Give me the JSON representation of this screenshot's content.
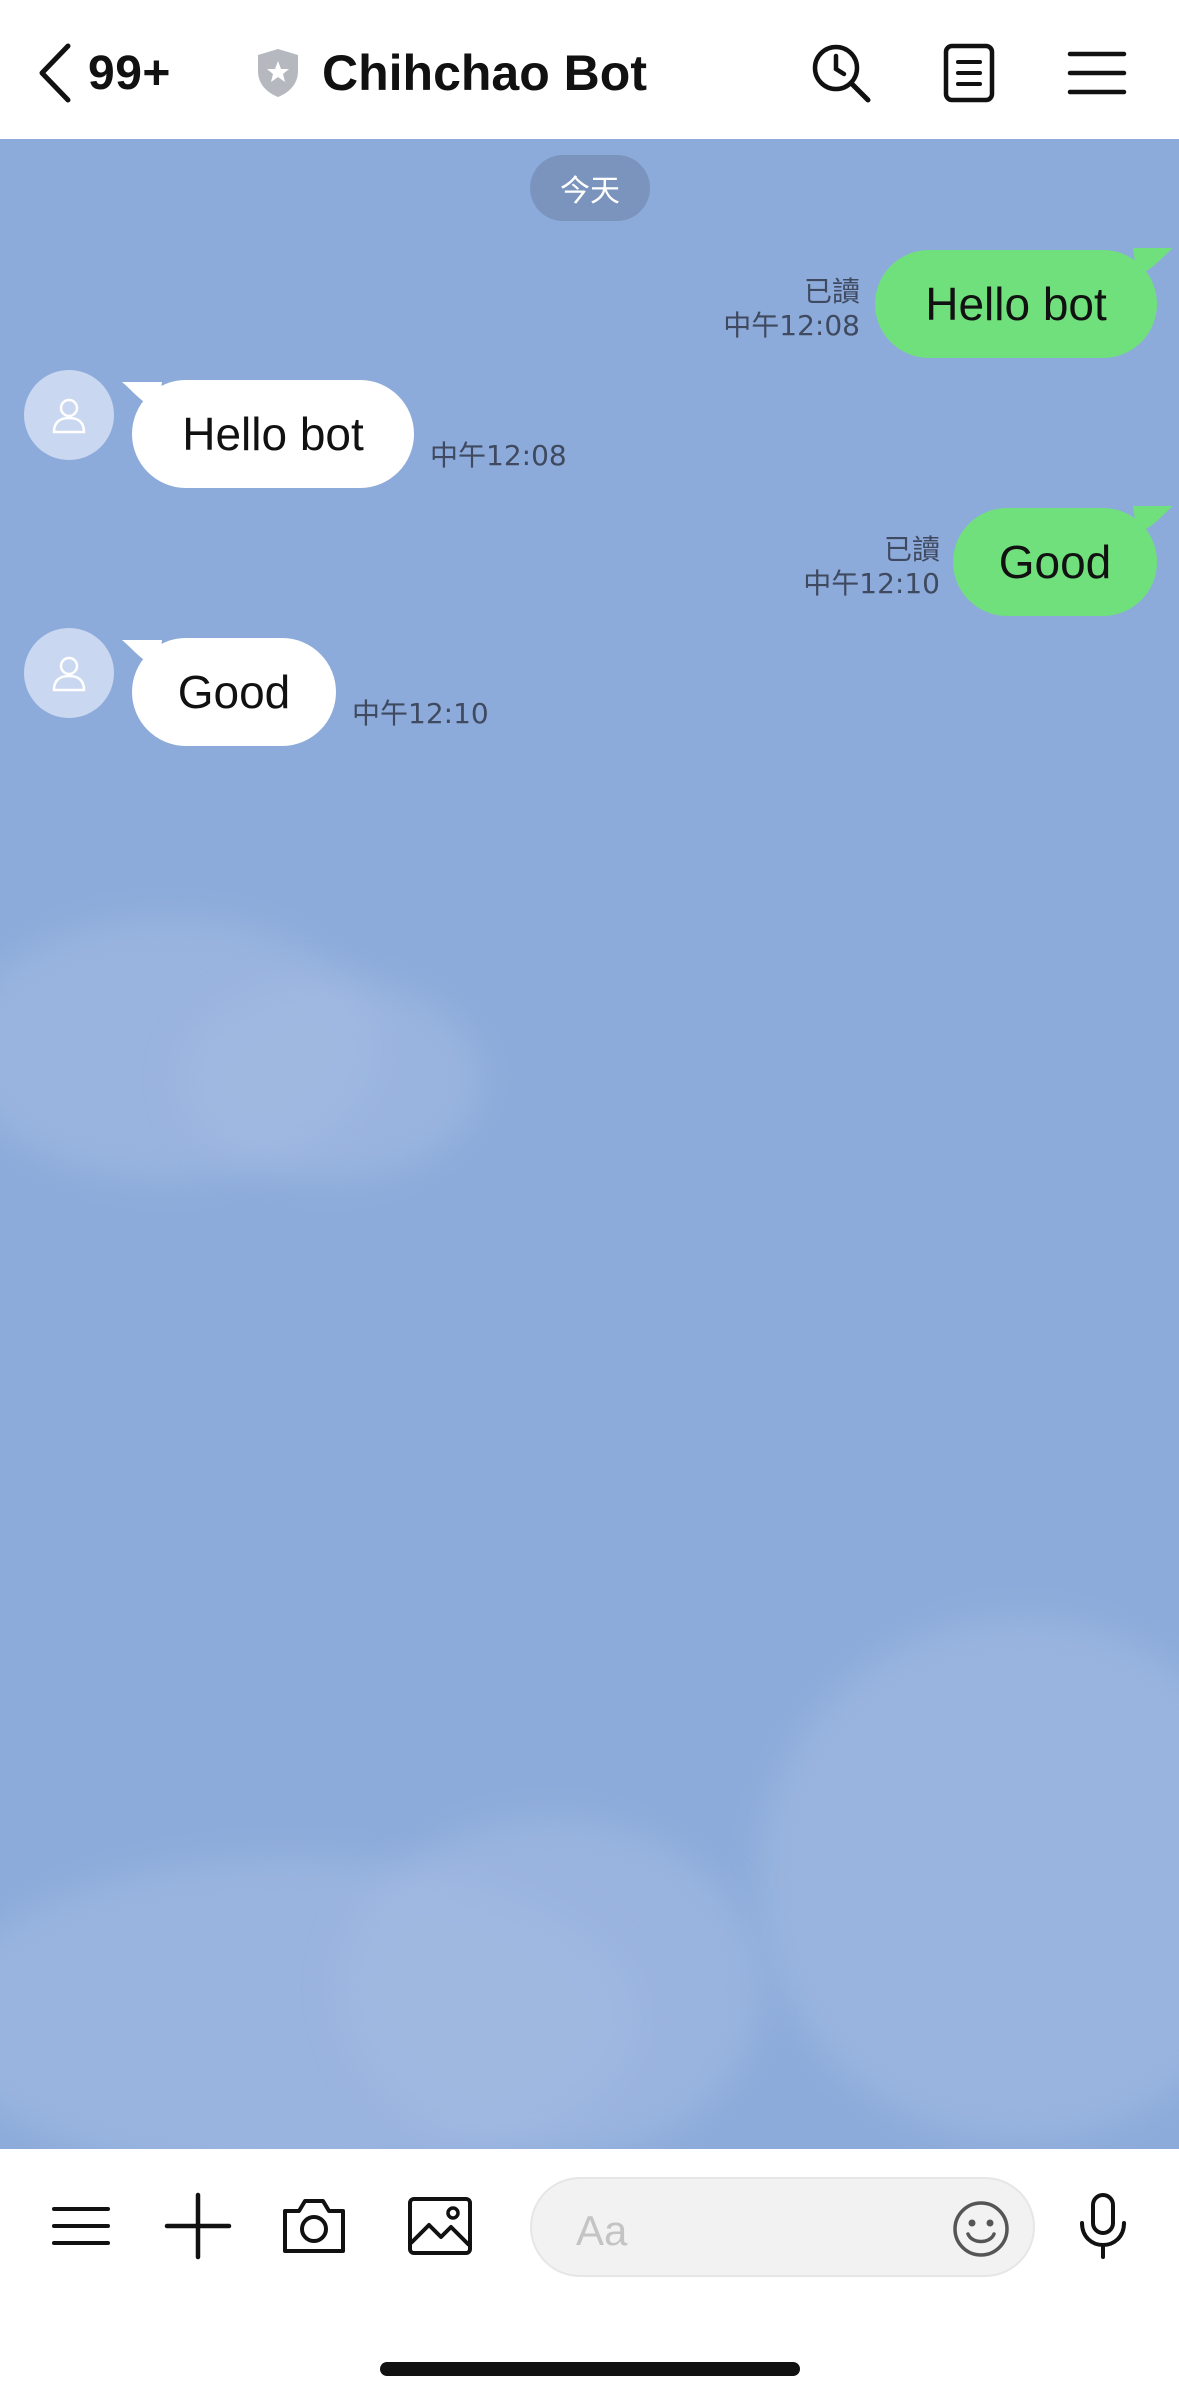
{
  "header": {
    "unread_count": "99+",
    "title": "Chihchao Bot",
    "icons": [
      "chevron-left-icon",
      "shield-icon",
      "search-clock-icon",
      "notes-icon",
      "menu-icon"
    ]
  },
  "chat": {
    "date_label": "今天",
    "messages": [
      {
        "direction": "out",
        "text": "Hello bot",
        "read": "已讀",
        "time": "中午12:08"
      },
      {
        "direction": "in",
        "text": "Hello bot",
        "time": "中午12:08"
      },
      {
        "direction": "out",
        "text": "Good",
        "read": "已讀",
        "time": "中午12:10"
      },
      {
        "direction": "in",
        "text": "Good",
        "time": "中午12:10"
      }
    ]
  },
  "composer": {
    "placeholder": "Aa",
    "icons": [
      "menu-icon",
      "plus-icon",
      "camera-icon",
      "image-icon",
      "emoji-icon",
      "microphone-icon"
    ]
  },
  "colors": {
    "chat_background": "#8dabda",
    "outgoing_bubble": "#6fe07c",
    "incoming_bubble": "#ffffff"
  }
}
